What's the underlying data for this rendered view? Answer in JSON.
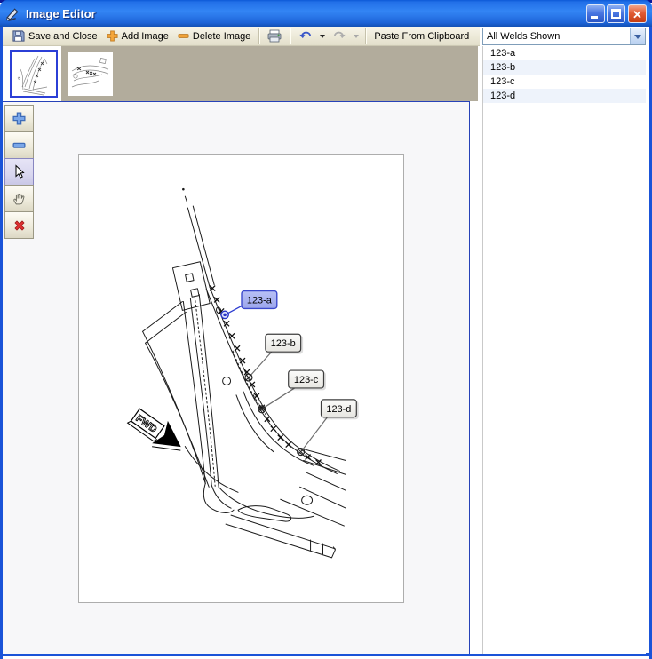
{
  "window": {
    "title": "Image Editor"
  },
  "toolbar": {
    "save_and_close": "Save and Close",
    "add_image": "Add Image",
    "delete_image": "Delete Image",
    "paste_from_clipboard": "Paste From Clipboard"
  },
  "filter": {
    "selected": "All Welds Shown"
  },
  "weld_list": {
    "items": [
      "123-a",
      "123-b",
      "123-c",
      "123-d"
    ]
  },
  "drawing": {
    "fwd": "FWD",
    "callouts": [
      {
        "label": "123-a",
        "selected": true
      },
      {
        "label": "123-b",
        "selected": false
      },
      {
        "label": "123-c",
        "selected": false
      },
      {
        "label": "123-d",
        "selected": false
      }
    ]
  },
  "icons": {
    "title": "pencil-check-icon",
    "save": "floppy-disk-icon",
    "add": "orange-plus-icon",
    "delete": "orange-minus-icon",
    "print": "printer-icon",
    "undo": "undo-arrow-icon",
    "redo": "redo-arrow-icon",
    "zoom_in": "plus-icon",
    "zoom_out": "minus-icon",
    "select": "cursor-arrow-icon",
    "pan": "hand-icon",
    "remove": "red-x-icon"
  },
  "colors": {
    "selection_fill": "#a9b2f1",
    "selection_border": "#3b49cc",
    "leader_blue": "#2b3bd0",
    "titlebar_blue": "#2a7df0",
    "toolbar_bg": "#ece9d8",
    "strip_bg": "#b2ac9c",
    "alt_row": "#eef3fb"
  }
}
